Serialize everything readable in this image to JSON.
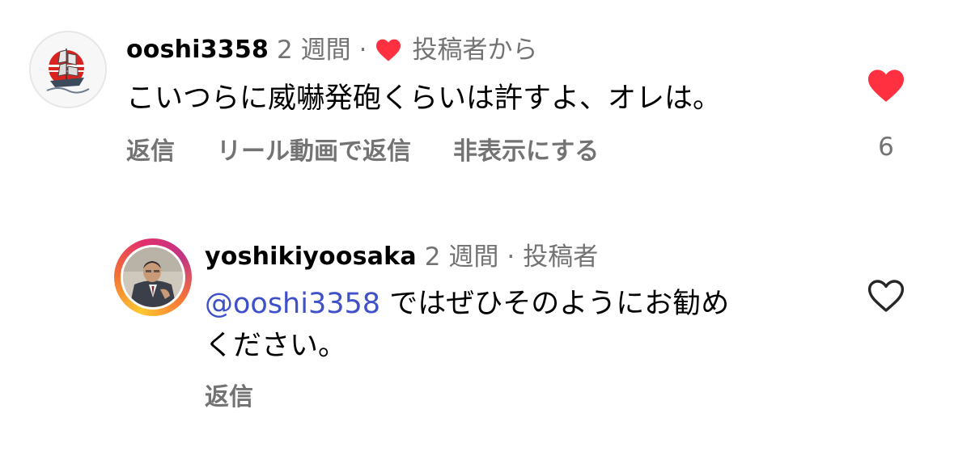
{
  "comments": [
    {
      "username": "ooshi3358",
      "time": "2 週間",
      "separator": "·",
      "liked_by_author_label": "投稿者から",
      "text": "こいつらに威嚇発砲くらいは許すよ、オレは。",
      "actions": {
        "reply": "返信",
        "reply_with_reel": "リール動画で返信",
        "hide": "非表示にする"
      },
      "like_count": "6",
      "liked": true,
      "avatar_icon": "sailing-ship-rising-sun-icon"
    },
    {
      "username": "yoshikiyoosaka",
      "time": "2 週間",
      "separator": "·",
      "author_label": "投稿者",
      "mention": "@ooshi3358",
      "text_line1": "ではぜひそのようにお勧め",
      "text_line2": "ください。",
      "actions": {
        "reply": "返信"
      },
      "liked": false,
      "avatar_icon": "man-in-suit-photo-icon"
    }
  ],
  "colors": {
    "heart_red": "#ff3040",
    "meta_gray": "#737373",
    "mention_blue": "#3f50c8"
  }
}
